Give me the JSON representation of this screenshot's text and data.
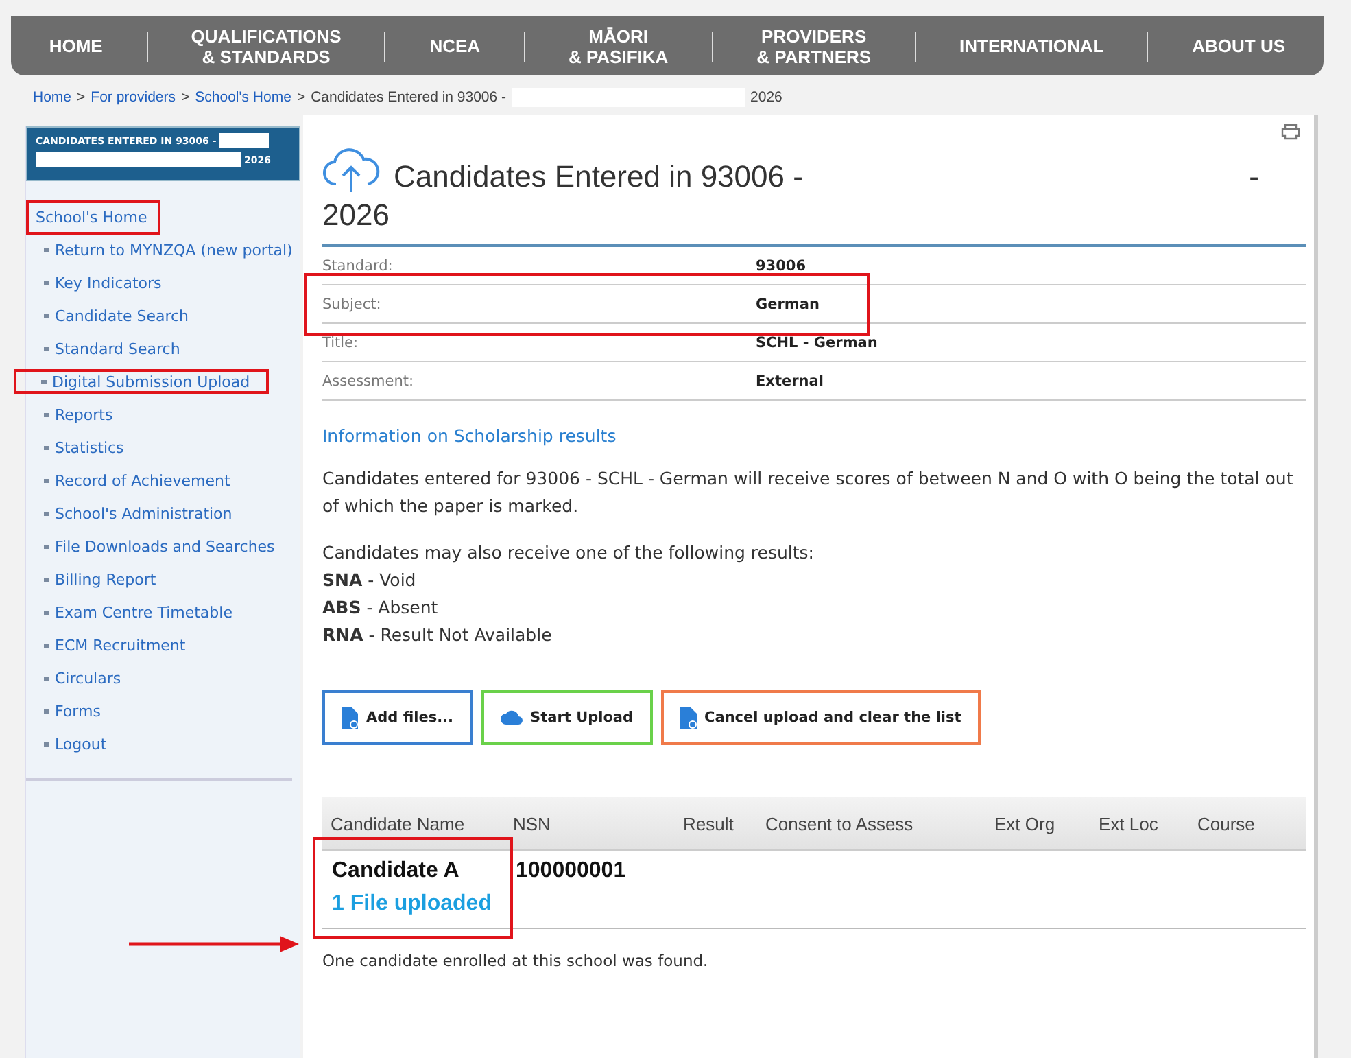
{
  "nav": {
    "items": [
      {
        "lines": [
          "HOME"
        ]
      },
      {
        "lines": [
          "QUALIFICATIONS",
          "& STANDARDS"
        ]
      },
      {
        "lines": [
          "NCEA"
        ]
      },
      {
        "lines": [
          "MĀORI",
          "& PASIFIKA"
        ]
      },
      {
        "lines": [
          "PROVIDERS",
          "& PARTNERS"
        ]
      },
      {
        "lines": [
          "INTERNATIONAL"
        ]
      },
      {
        "lines": [
          "ABOUT US"
        ]
      }
    ]
  },
  "breadcrumb": {
    "links": [
      "Home",
      "For providers",
      "School's Home"
    ],
    "separator": ">",
    "current": "Candidates Entered in 93006 -",
    "current_end": "2026"
  },
  "sidebar": {
    "header": {
      "title": "CANDIDATES ENTERED IN 93006 -",
      "year": "2026"
    },
    "home_link": {
      "label": "School's Home",
      "highlighted": true
    },
    "items": [
      {
        "label": "Return to MYNZQA (new portal)",
        "highlighted": false
      },
      {
        "label": "Key Indicators",
        "highlighted": false
      },
      {
        "label": "Candidate Search",
        "highlighted": false
      },
      {
        "label": "Standard Search",
        "highlighted": false
      },
      {
        "label": "Digital Submission Upload",
        "highlighted": true
      },
      {
        "label": "Reports",
        "highlighted": false
      },
      {
        "label": "Statistics",
        "highlighted": false
      },
      {
        "label": "Record of Achievement",
        "highlighted": false
      },
      {
        "label": "School's Administration",
        "highlighted": false
      },
      {
        "label": "File Downloads and Searches",
        "highlighted": false
      },
      {
        "label": "Billing Report",
        "highlighted": false
      },
      {
        "label": "Exam Centre Timetable",
        "highlighted": false
      },
      {
        "label": "ECM Recruitment",
        "highlighted": false
      },
      {
        "label": "Circulars",
        "highlighted": false
      },
      {
        "label": "Forms",
        "highlighted": false
      },
      {
        "label": "Logout",
        "highlighted": false
      }
    ]
  },
  "page": {
    "title": "Candidates Entered in 93006 -",
    "title_dash": "-",
    "title_year": "2026",
    "details": [
      {
        "label": "Standard:",
        "value": "93006",
        "highlighted": false
      },
      {
        "label": "Subject:",
        "value": "German",
        "highlighted": true
      },
      {
        "label": "Title:",
        "value": "SCHL - German",
        "highlighted": false
      },
      {
        "label": "Assessment:",
        "value": "External",
        "highlighted": false
      }
    ],
    "info_link": "Information on Scholarship results",
    "info_text": "Candidates entered for 93006 - SCHL - German will receive scores of between N and O with O being the total out of which the paper is marked.",
    "results_intro": "Candidates may also receive one of the following results:",
    "results": [
      "**SNA** - Void",
      "**ABS** - Absent",
      "**RNA** - Result Not Available"
    ],
    "buttons": [
      {
        "label": "Add files...",
        "kind": "add"
      },
      {
        "label": "Start Upload",
        "kind": "start"
      },
      {
        "label": "Cancel upload and clear the list",
        "kind": "cancel"
      }
    ],
    "table": {
      "columns": [
        "Candidate Name",
        "NSN",
        "Result",
        "Consent to Assess",
        "Ext Org",
        "Ext Loc",
        "Course"
      ],
      "rows": [
        {
          "name": "Candidate A",
          "nsn": "100000001",
          "files": "1 File uploaded",
          "highlighted": true
        }
      ]
    },
    "footer": "One candidate enrolled at this school was found."
  }
}
